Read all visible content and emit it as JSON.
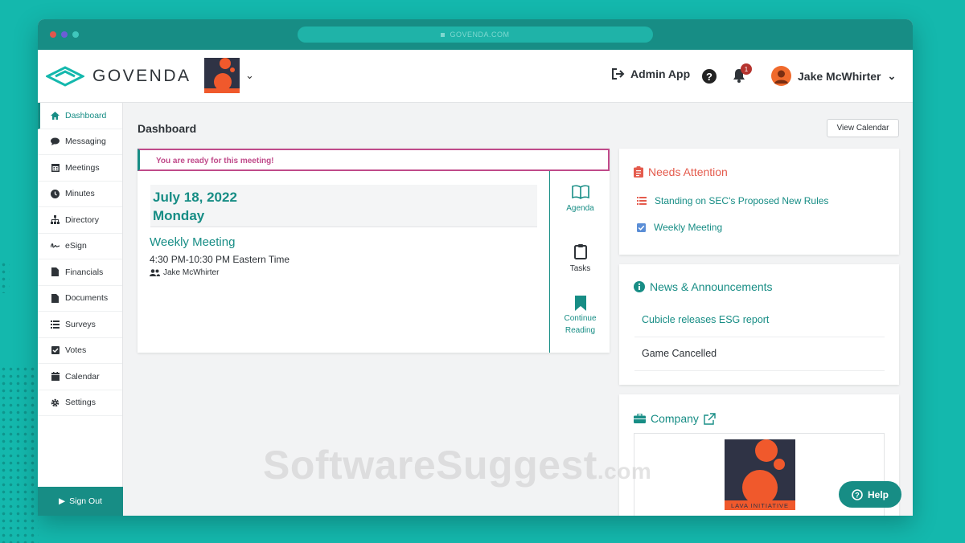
{
  "browser": {
    "url": "GOVENDA.COM"
  },
  "header": {
    "brand": "GOVENDA",
    "org_logo_caption": "LAVA INITIATIVE",
    "admin_label": "Admin App",
    "help_glyph": "?",
    "notification_count": "1",
    "user_name": "Jake McWhirter"
  },
  "sidebar": {
    "items": [
      {
        "label": "Dashboard",
        "icon": "home-icon"
      },
      {
        "label": "Messaging",
        "icon": "chat-icon"
      },
      {
        "label": "Meetings",
        "icon": "calendar-grid-icon"
      },
      {
        "label": "Minutes",
        "icon": "clock-icon"
      },
      {
        "label": "Directory",
        "icon": "sitemap-icon"
      },
      {
        "label": "eSign",
        "icon": "signature-icon"
      },
      {
        "label": "Financials",
        "icon": "file-icon"
      },
      {
        "label": "Documents",
        "icon": "file-icon"
      },
      {
        "label": "Surveys",
        "icon": "list-icon"
      },
      {
        "label": "Votes",
        "icon": "checkbox-icon"
      },
      {
        "label": "Calendar",
        "icon": "calendar-icon"
      },
      {
        "label": "Settings",
        "icon": "gear-icon"
      }
    ],
    "sign_out": "Sign Out"
  },
  "main": {
    "title": "Dashboard",
    "view_calendar": "View Calendar",
    "meeting": {
      "ready_text": "You are ready for this meeting!",
      "date": "July 18, 2022",
      "weekday": "Monday",
      "title": "Weekly Meeting",
      "time": "4:30 PM-10:30 PM  Eastern Time",
      "owner": "Jake McWhirter",
      "actions": {
        "agenda": "Agenda",
        "tasks": "Tasks",
        "continue_1": "Continue",
        "continue_2": "Reading"
      }
    }
  },
  "needs_attention": {
    "title": "Needs Attention",
    "items": [
      "Standing on SEC's Proposed New Rules",
      "Weekly Meeting"
    ]
  },
  "news": {
    "title": "News & Announcements",
    "items": [
      "Cubicle releases ESG report",
      "Game Cancelled"
    ]
  },
  "company": {
    "title": "Company",
    "logo_caption": "LAVA INITIATIVE"
  },
  "watermark": {
    "main": "SoftwareSuggest",
    "suffix": ".com"
  },
  "help_button": "Help",
  "colors": {
    "teal": "#178d85",
    "background": "#14b8ad",
    "alert": "#e45b4d",
    "pink": "#c04a8a",
    "orange": "#f06a2c"
  }
}
